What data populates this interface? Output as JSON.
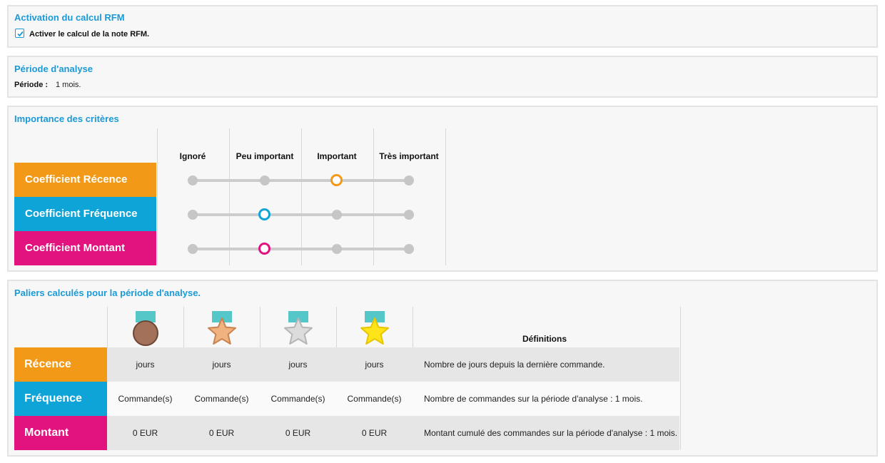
{
  "activation": {
    "title": "Activation du calcul RFM",
    "checkbox_label": "Activer le calcul de la note RFM.",
    "checked": true
  },
  "period": {
    "title": "Période d'analyse",
    "label": "Période :",
    "value": "1 mois."
  },
  "criteria": {
    "title": "Importance des critères",
    "columns": [
      "Ignoré",
      "Peu important",
      "Important",
      "Très important"
    ],
    "rows": [
      {
        "label": "Coefficient Récence",
        "color": "#f29a17",
        "selected_index": 2
      },
      {
        "label": "Coefficient Fréquence",
        "color": "#0fa4d8",
        "selected_index": 1
      },
      {
        "label": "Coefficient Montant",
        "color": "#e2127e",
        "selected_index": 1
      }
    ]
  },
  "tiers": {
    "title": "Paliers calculés pour la période d'analyse.",
    "medals": [
      "bronze-medal-icon",
      "copper-star-medal-icon",
      "silver-star-medal-icon",
      "gold-star-medal-icon"
    ],
    "definitions_header": "Définitions",
    "rows": [
      {
        "label": "Récence",
        "color": "#f29a17",
        "cells": [
          "jours",
          "jours",
          "jours",
          "jours"
        ],
        "definition": "Nombre de jours depuis la dernière commande."
      },
      {
        "label": "Fréquence",
        "color": "#0fa4d8",
        "cells": [
          "Commande(s)",
          "Commande(s)",
          "Commande(s)",
          "Commande(s)"
        ],
        "definition": "Nombre de commandes sur la période d'analyse : 1 mois."
      },
      {
        "label": "Montant",
        "color": "#e2127e",
        "cells": [
          "0 EUR",
          "0 EUR",
          "0 EUR",
          "0 EUR"
        ],
        "definition": "Montant cumulé des commandes sur la période d'analyse : 1 mois."
      }
    ]
  }
}
